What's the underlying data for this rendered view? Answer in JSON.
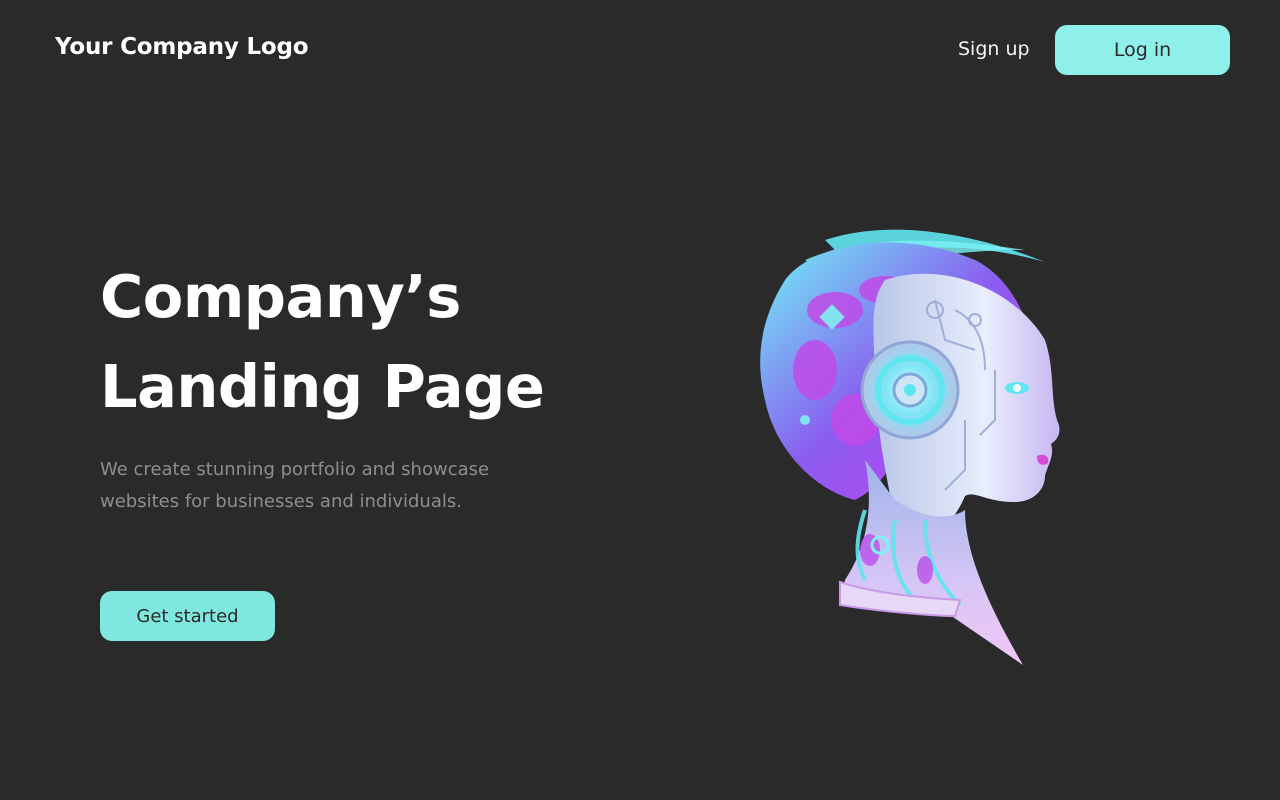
{
  "header": {
    "logo_text": "Your Company Logo",
    "signup_label": "Sign up",
    "login_label": "Log in"
  },
  "hero": {
    "title_line1": "Company’s",
    "title_line2": "Landing Page",
    "description": "We create stunning portfolio and showcase websites for businesses and individuals.",
    "cta_label": "Get started",
    "image": "cyborg-head-illustration"
  },
  "colors": {
    "background": "#2a2a2a",
    "accent": "#8ff0ea",
    "accent_cta": "#7fe8de",
    "text_primary": "#ffffff",
    "text_muted": "#8e8e8e",
    "illustration_cyan": "#5fe6f0",
    "illustration_magenta": "#c63cf0"
  }
}
